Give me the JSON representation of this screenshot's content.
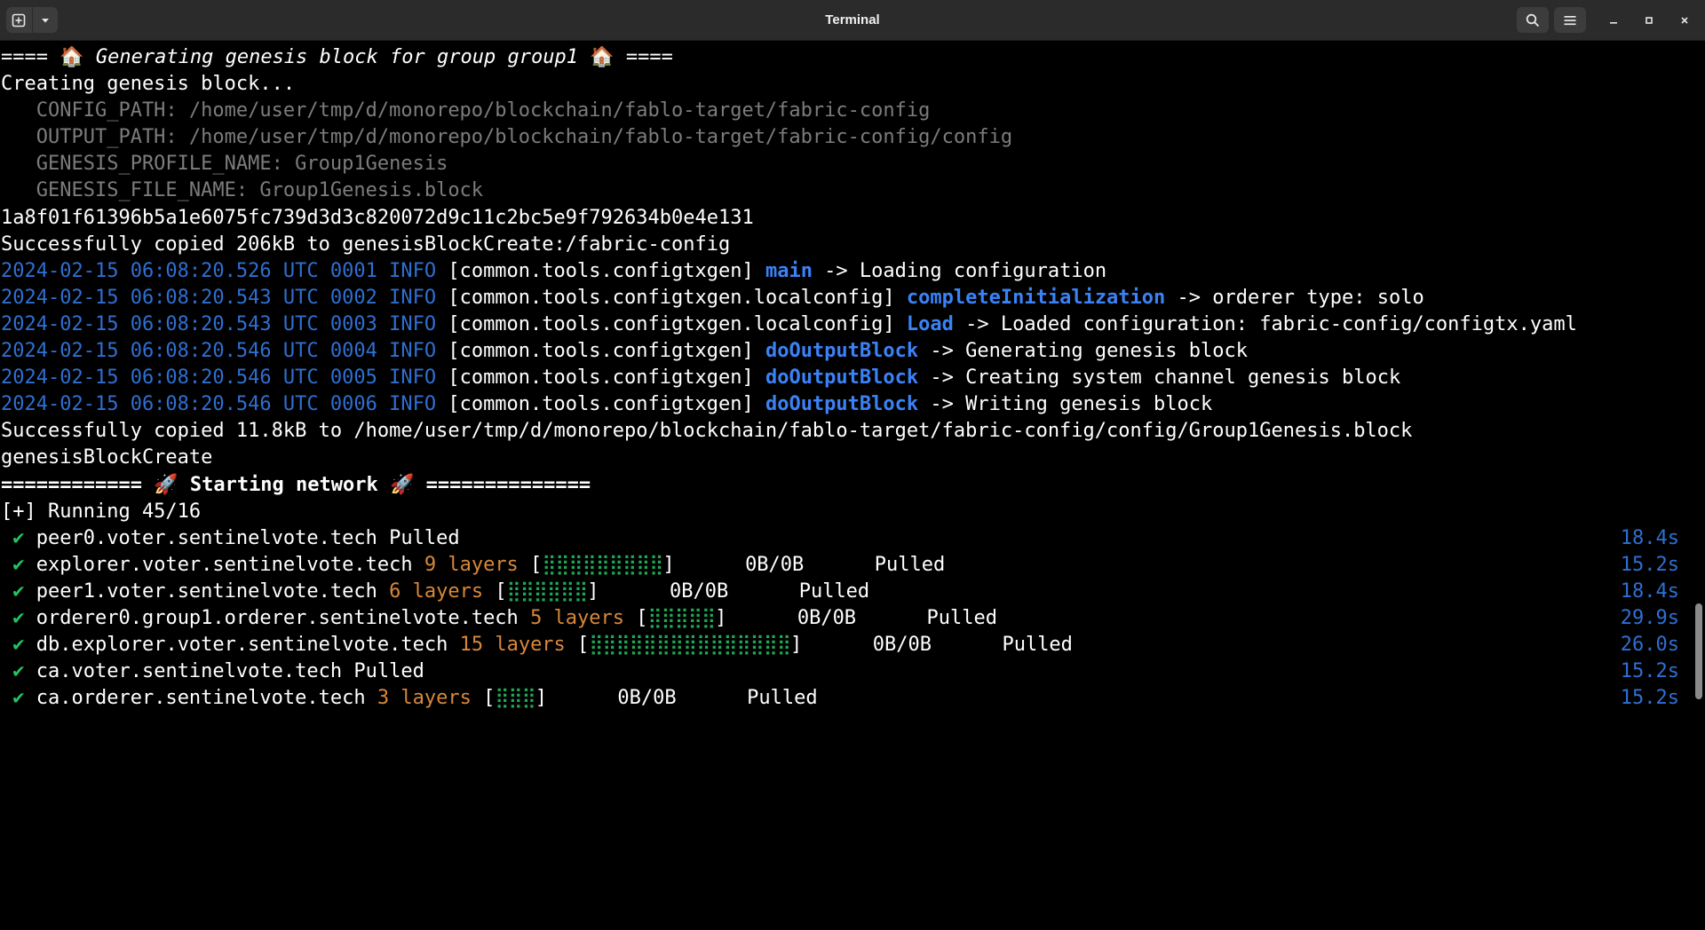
{
  "window": {
    "title": "Terminal",
    "new_tab_icon": "new-tab-icon",
    "dropdown_icon": "chevron-down-icon",
    "search_icon": "search-icon",
    "menu_icon": "hamburger-menu-icon",
    "minimize_icon": "minimize-icon",
    "maximize_icon": "maximize-icon",
    "close_icon": "close-icon"
  },
  "colors": {
    "background": "#000000",
    "titlebar": "#2b2b2b",
    "timestamp_blue": "#2f6fd2",
    "function_blue": "#3b82f6",
    "layers_orange": "#d8883a",
    "check_green": "#22c55e",
    "dim_gray": "#7c7c7c"
  },
  "terminal": {
    "header": {
      "prefix": "==== ",
      "emoji1": "🏠",
      "text": " Generating genesis block for group group1 ",
      "emoji2": "🏠",
      "suffix": " ===="
    },
    "creating": "Creating genesis block...",
    "config_lines": [
      "   CONFIG_PATH: /home/user/tmp/d/monorepo/blockchain/fablo-target/fabric-config",
      "   OUTPUT_PATH: /home/user/tmp/d/monorepo/blockchain/fablo-target/fabric-config/config",
      "   GENESIS_PROFILE_NAME: Group1Genesis",
      "   GENESIS_FILE_NAME: Group1Genesis.block"
    ],
    "container_id": "1a8f01f61396b5a1e6075fc739d3d3c820072d9c11c2bc5e9f792634b0e4e131",
    "copied1": "Successfully copied 206kB to genesisBlockCreate:/fabric-config",
    "log_lines": [
      {
        "ts": "2024-02-15 06:08:20.526 UTC 0001 INFO ",
        "module": "[common.tools.configtxgen] ",
        "func": "main",
        "msg": " -> Loading configuration"
      },
      {
        "ts": "2024-02-15 06:08:20.543 UTC 0002 INFO ",
        "module": "[common.tools.configtxgen.localconfig] ",
        "func": "completeInitialization",
        "msg": " -> orderer type: solo"
      },
      {
        "ts": "2024-02-15 06:08:20.543 UTC 0003 INFO ",
        "module": "[common.tools.configtxgen.localconfig] ",
        "func": "Load",
        "msg": " -> Loaded configuration: fabric-config/configtx.yaml"
      },
      {
        "ts": "2024-02-15 06:08:20.546 UTC 0004 INFO ",
        "module": "[common.tools.configtxgen] ",
        "func": "doOutputBlock",
        "msg": " -> Generating genesis block"
      },
      {
        "ts": "2024-02-15 06:08:20.546 UTC 0005 INFO ",
        "module": "[common.tools.configtxgen] ",
        "func": "doOutputBlock",
        "msg": " -> Creating system channel genesis block"
      },
      {
        "ts": "2024-02-15 06:08:20.546 UTC 0006 INFO ",
        "module": "[common.tools.configtxgen] ",
        "func": "doOutputBlock",
        "msg": " -> Writing genesis block"
      }
    ],
    "copied2": "Successfully copied 11.8kB to /home/user/tmp/d/monorepo/blockchain/fablo-target/fabric-config/config/Group1Genesis.block",
    "container_name": "genesisBlockCreate",
    "network": {
      "prefix": "============ ",
      "emoji1": "🚀",
      "text": " Starting network ",
      "emoji2": "🚀",
      "suffix": " =============="
    },
    "running": "[+] Running 45/16",
    "pulls": [
      {
        "check": "✔",
        "name": "peer0.voter.sentinelvote.tech",
        "layers": "",
        "bar": "",
        "size": "",
        "status": "Pulled",
        "time": "18.4s"
      },
      {
        "check": "✔",
        "name": "explorer.voter.sentinelvote.tech",
        "layers": "9 layers",
        "bar": "⣿⣿⣿⣿⣿⣿⣿⣿⣿",
        "size": "0B/0B",
        "status": "Pulled",
        "time": "15.2s"
      },
      {
        "check": "✔",
        "name": "peer1.voter.sentinelvote.tech",
        "layers": "6 layers",
        "bar": "⣿⣿⣿⣿⣿⣿",
        "size": "0B/0B",
        "status": "Pulled",
        "time": "18.4s"
      },
      {
        "check": "✔",
        "name": "orderer0.group1.orderer.sentinelvote.tech",
        "layers": "5 layers",
        "bar": "⣿⣿⣿⣿⣿",
        "size": "0B/0B",
        "status": "Pulled",
        "time": "29.9s"
      },
      {
        "check": "✔",
        "name": "db.explorer.voter.sentinelvote.tech",
        "layers": "15 layers",
        "bar": "⣿⣿⣿⣿⣿⣿⣿⣿⣿⣿⣿⣿⣿⣿⣿",
        "size": "0B/0B",
        "status": "Pulled",
        "time": "26.0s"
      },
      {
        "check": "✔",
        "name": "ca.voter.sentinelvote.tech",
        "layers": "",
        "bar": "",
        "size": "",
        "status": "Pulled",
        "time": "15.2s"
      },
      {
        "check": "✔",
        "name": "ca.orderer.sentinelvote.tech",
        "layers": "3 layers",
        "bar": "⣿⣿⣿",
        "size": "0B/0B",
        "status": "Pulled",
        "time": "15.2s"
      }
    ]
  }
}
